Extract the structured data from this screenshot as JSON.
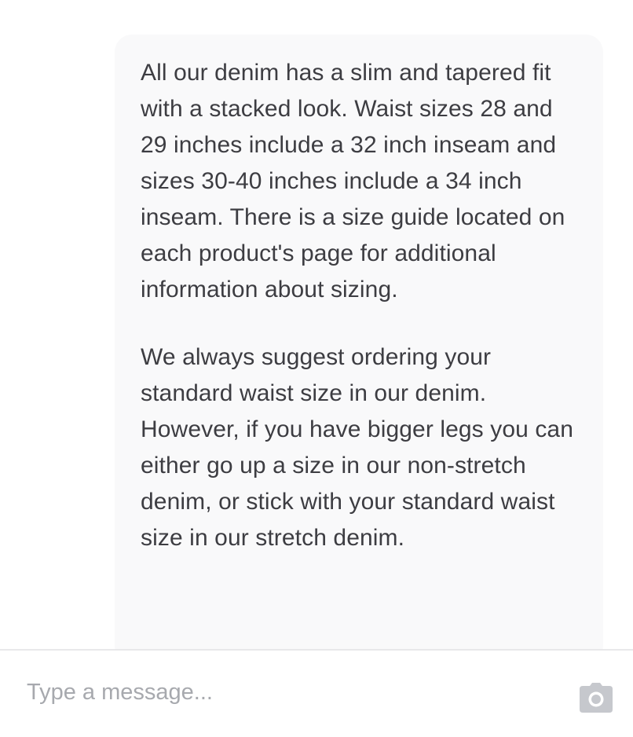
{
  "conversation": {
    "messages": [
      {
        "paragraphs": [
          "All our denim has a slim and tapered fit with a stacked look. Waist sizes 28 and 29 inches include a 32 inch inseam and sizes 30-40 inches include a 34 inch inseam. There is a size guide located on each product's page for additional information about sizing.",
          "We always suggest ordering your standard waist size in our denim. However, if you have bigger legs you can either go up a size in our non-stretch denim, or stick with your standard waist size in our stretch denim."
        ]
      }
    ]
  },
  "composer": {
    "value": "",
    "placeholder": "Type a message...",
    "attach_icon": "camera-icon"
  },
  "colors": {
    "bubble_background": "#f9f9fa",
    "text": "#3d3d42",
    "placeholder": "#a7a9ae",
    "icon": "#c6c8cd",
    "divider": "#e8e8ea"
  }
}
